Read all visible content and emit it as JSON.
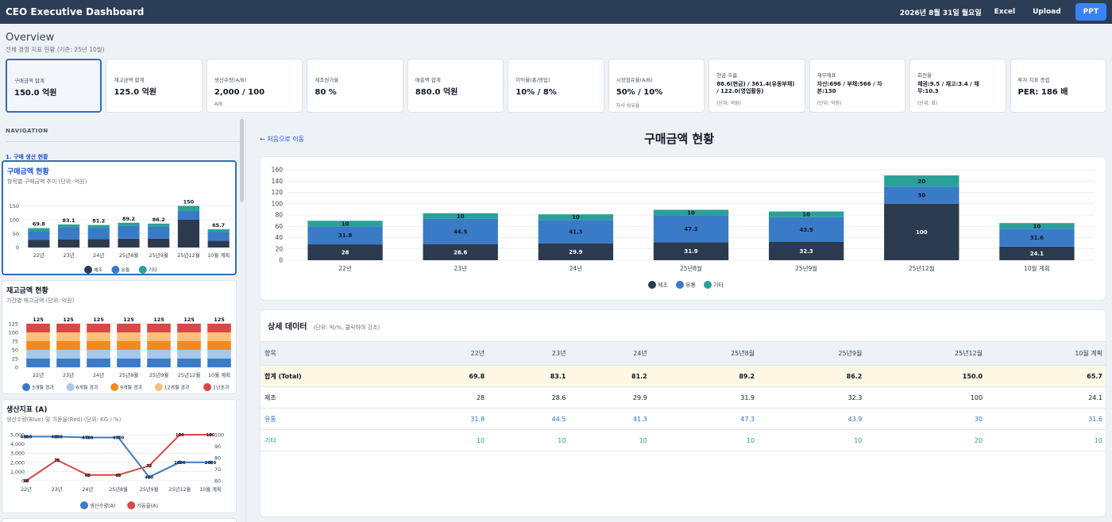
{
  "topbar": {
    "title": "CEO Executive Dashboard",
    "date": "2026년 8월 31일 월요일",
    "excel": "Excel",
    "upload": "Upload",
    "ppt": "PPT"
  },
  "overview": {
    "title": "Overview",
    "subtitle": "전체 경영 지표 현황 (기준: 25년 10월)"
  },
  "kpis": [
    {
      "label": "구매금액 합계",
      "value": "150.0 억원",
      "note": ""
    },
    {
      "label": "재고금액 합계",
      "value": "125.0 억원",
      "note": ""
    },
    {
      "label": "생산수량(A/B)",
      "value": "2,000 / 100",
      "note": "A/B"
    },
    {
      "label": "제조원가율",
      "value": "80 %",
      "note": ""
    },
    {
      "label": "매출액 합계",
      "value": "880.0 억원",
      "note": ""
    },
    {
      "label": "이익율(총/영업)",
      "value": "10% / 8%",
      "note": ""
    },
    {
      "label": "시장점유율(A/B)",
      "value": "50% / 10%",
      "note": "자사 성유율"
    },
    {
      "label": "현금 흐름",
      "value": "88.6(현금) / 361.4(유동부채) / 122.0(영업활동)",
      "note": "(단위: 억원)"
    },
    {
      "label": "재무제표",
      "value": "자산:696 / 부채:566 / 자본:130",
      "note": "(단위: 억원)"
    },
    {
      "label": "회전율",
      "value": "채권:9.5 / 재고:3.4 / 채무:10.3",
      "note": "(단위: 회)"
    },
    {
      "label": "투자 지표 종합",
      "value": "PER: 186 배",
      "note": ""
    }
  ],
  "nav": {
    "label": "NAVIGATION",
    "section": "1. 구매 생산 현황"
  },
  "cards": {
    "purchase": {
      "title": "구매금액 현황",
      "subtitle": "항목별 구매금액 추이 (단위: 억원)"
    },
    "inventory": {
      "title": "재고금액 현황",
      "subtitle": "기간별 재고금액 (단위: 억원)"
    },
    "production": {
      "title": "생산지표 (A)",
      "subtitle": "생산수량(Blue) 및 가동율(Red) (단위: KG / %)"
    }
  },
  "content": {
    "back": "← 처음으로 이동",
    "title": "구매금액 현황"
  },
  "table": {
    "title": "상세 데이터",
    "unit": "(단위: 억/%, 클릭하여 강조)",
    "headers": [
      "항목",
      "22년",
      "23년",
      "24년",
      "25년8월",
      "25년9월",
      "25년12월",
      "10월 계획"
    ],
    "rows": [
      {
        "cls": "total",
        "cells": [
          "합계 (Total)",
          "69.8",
          "83.1",
          "81.2",
          "89.2",
          "86.2",
          "150.0",
          "65.7"
        ]
      },
      {
        "cls": "r-jejo",
        "cells": [
          "제조",
          "28",
          "28.6",
          "29.9",
          "31.9",
          "32.3",
          "100",
          "24.1"
        ]
      },
      {
        "cls": "r-yutong",
        "cells": [
          "유통",
          "31.8",
          "44.5",
          "41.3",
          "47.3",
          "43.9",
          "30",
          "31.6"
        ]
      },
      {
        "cls": "r-gita",
        "cells": [
          "기타",
          "10",
          "10",
          "10",
          "10",
          "10",
          "20",
          "10"
        ]
      }
    ]
  },
  "colors": {
    "jejo": "#2c3a4f",
    "yutong": "#3a7bc8",
    "gita": "#2aa198",
    "inv1": "#3a7bc8",
    "inv2": "#a8c8ea",
    "inv3": "#f28a1e",
    "inv4": "#fbbf7a",
    "inv5": "#d94848",
    "prod": "#3a7bc8",
    "util": "#d94848"
  },
  "chart_data": [
    {
      "type": "bar",
      "stacked": true,
      "title": "구매금액 현황",
      "categories": [
        "22년",
        "23년",
        "24년",
        "25년8월",
        "25년9월",
        "25년12월",
        "10월 계획"
      ],
      "series": [
        {
          "name": "제조",
          "values": [
            28,
            28.6,
            29.9,
            31.9,
            32.3,
            100,
            24.1
          ]
        },
        {
          "name": "유통",
          "values": [
            31.8,
            44.5,
            41.3,
            47.3,
            43.9,
            30,
            31.6
          ]
        },
        {
          "name": "기타",
          "values": [
            10,
            10,
            10,
            10,
            10,
            20,
            10
          ]
        }
      ],
      "totals": [
        69.8,
        83.1,
        81.2,
        89.2,
        86.2,
        150,
        65.7
      ],
      "ylim": [
        0,
        160
      ],
      "legend": "bottom"
    },
    {
      "type": "bar",
      "stacked": true,
      "title": "재고금액 현황",
      "categories": [
        "22년",
        "23년",
        "24년",
        "25년8월",
        "25년9월",
        "25년12월",
        "10월 계획"
      ],
      "series": [
        {
          "name": "3개월 경과",
          "values": [
            25,
            25,
            25,
            25,
            25,
            25,
            25
          ]
        },
        {
          "name": "6개월 경과",
          "values": [
            25,
            25,
            25,
            25,
            25,
            25,
            25
          ]
        },
        {
          "name": "9개월 경과",
          "values": [
            25,
            25,
            25,
            25,
            25,
            25,
            25
          ]
        },
        {
          "name": "12개월 경과",
          "values": [
            25,
            25,
            25,
            25,
            25,
            25,
            25
          ]
        },
        {
          "name": "1년초과",
          "values": [
            25,
            25,
            25,
            25,
            25,
            25,
            25
          ]
        }
      ],
      "totals": [
        125,
        125,
        125,
        125,
        125,
        125,
        125
      ],
      "ylim": [
        0,
        125
      ],
      "legend": "bottom"
    },
    {
      "type": "line",
      "title": "생산지표 (A)",
      "categories": [
        "22년",
        "23년",
        "24년",
        "25년8월",
        "25년9월",
        "25년12월",
        "10월 계획"
      ],
      "series": [
        {
          "name": "생산수량(A)",
          "axis": "left",
          "values": [
            4800,
            4800,
            4700,
            4700,
            400,
            2000,
            2000
          ]
        },
        {
          "name": "가동율(A)",
          "axis": "right",
          "values": [
            60,
            78,
            65,
            65,
            73,
            100,
            100
          ]
        }
      ],
      "ylim_left": [
        0,
        5000
      ],
      "ylim_right": [
        60,
        100
      ],
      "legend": "bottom"
    }
  ]
}
